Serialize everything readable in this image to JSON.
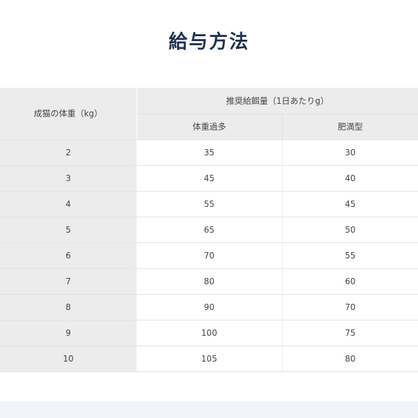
{
  "title": "給与方法",
  "table": {
    "corner_header": "成猫の体重（kg）",
    "group_header": "推奨給餌量（1日あたりg）",
    "sub_headers": [
      "体重過多",
      "肥満型"
    ],
    "rows": [
      {
        "weight": "2",
        "overweight": "35",
        "obese": "30"
      },
      {
        "weight": "3",
        "overweight": "45",
        "obese": "40"
      },
      {
        "weight": "4",
        "overweight": "55",
        "obese": "45"
      },
      {
        "weight": "5",
        "overweight": "65",
        "obese": "50"
      },
      {
        "weight": "6",
        "overweight": "70",
        "obese": "55"
      },
      {
        "weight": "7",
        "overweight": "80",
        "obese": "60"
      },
      {
        "weight": "8",
        "overweight": "90",
        "obese": "70"
      },
      {
        "weight": "9",
        "overweight": "100",
        "obese": "75"
      },
      {
        "weight": "10",
        "overweight": "105",
        "obese": "80"
      }
    ]
  }
}
